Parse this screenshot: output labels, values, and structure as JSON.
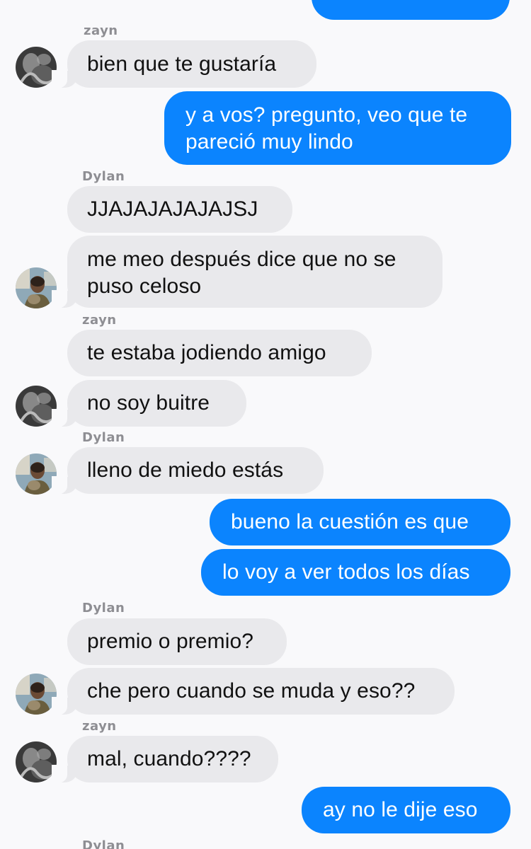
{
  "senders": {
    "zayn": "zayn",
    "dylan": "Dylan"
  },
  "messages": {
    "m_top": "",
    "m1": "bien que te gustaría",
    "m2": "y a vos? pregunto, veo que te\npareció muy lindo",
    "m3": "JJAJAJAJAJAJSJ",
    "m4": "me meo después dice que no se\npuso celoso",
    "m5": "te estaba jodiendo amigo",
    "m6": "no soy buitre",
    "m7": "lleno de miedo estás",
    "m8": "bueno la cuestión es que",
    "m9": "lo voy a ver todos los días",
    "m10": "premio o premio?",
    "m11": "che pero cuando se muda y eso??",
    "m12": "mal, cuando????",
    "m13": "ay no le dije eso"
  },
  "colors": {
    "sent_bubble": "#0b84fe",
    "received_bubble": "#e9e9ec",
    "background": "#f9f9fb",
    "sender_label": "#8e8e93"
  },
  "avatars": {
    "zayn": "avatar-zayn-photo",
    "dylan": "avatar-dylan-photo"
  }
}
